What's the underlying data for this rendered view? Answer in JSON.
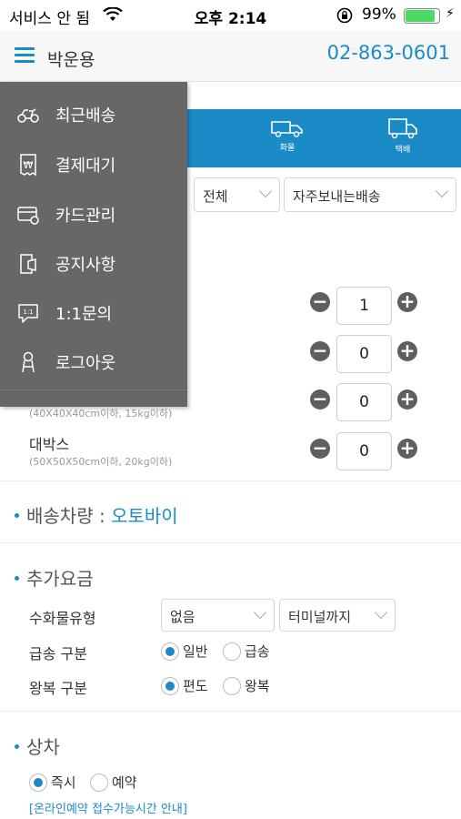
{
  "status_bar": {
    "carrier": "서비스 안 됨",
    "time": "오후 2:14",
    "battery": "99%",
    "battery_level": 0.99
  },
  "header": {
    "user_name": "박운용",
    "phone": "02-863-0601"
  },
  "vehicle_tabs": [
    {
      "label": "화물",
      "icon": "truck-icon"
    },
    {
      "label": "택배",
      "icon": "parcel-truck-icon"
    }
  ],
  "filters": {
    "region": "전체",
    "delivery_type": "자주보내는배송"
  },
  "packages": [
    {
      "label": "",
      "spec": "",
      "qty": "1"
    },
    {
      "label": "",
      "spec": "",
      "qty": "0"
    },
    {
      "label": "",
      "spec": "(40X40X40cm이하, 15kg이하)",
      "qty": "0"
    },
    {
      "label": "대박스",
      "spec": "(50X50X50cm이하, 20kg이하)",
      "qty": "0"
    }
  ],
  "vehicle_section": {
    "title": "배송차량 :",
    "value": "오토바이"
  },
  "extra_fee": {
    "title": "추가요금",
    "cargo_type_label": "수화물유형",
    "cargo_type_value": "없음",
    "cargo_dest_value": "터미널까지",
    "urgency_label": "급송 구분",
    "urgency_options": [
      "일반",
      "급송"
    ],
    "urgency_selected": "일반",
    "round_label": "왕복 구분",
    "round_options": [
      "편도",
      "왕복"
    ],
    "round_selected": "편도"
  },
  "pickup": {
    "title": "상차",
    "options": [
      "즉시",
      "예약"
    ],
    "selected": "즉시",
    "notice": "[온라인예약 접수가능시간 안내]"
  },
  "drawer": {
    "items": [
      {
        "label": "최근배송",
        "icon": "scooter-icon"
      },
      {
        "label": "결제대기",
        "icon": "won-receipt-icon"
      },
      {
        "label": "카드관리",
        "icon": "card-icon"
      },
      {
        "label": "공지사항",
        "icon": "notice-icon"
      },
      {
        "label": "1:1문의",
        "icon": "chat-bubble-icon"
      },
      {
        "label": "로그아웃",
        "icon": "logout-person-icon"
      }
    ]
  },
  "colors": {
    "accent": "#1a8bc6",
    "drawer_bg": "#676767",
    "battery": "#4cd964"
  }
}
